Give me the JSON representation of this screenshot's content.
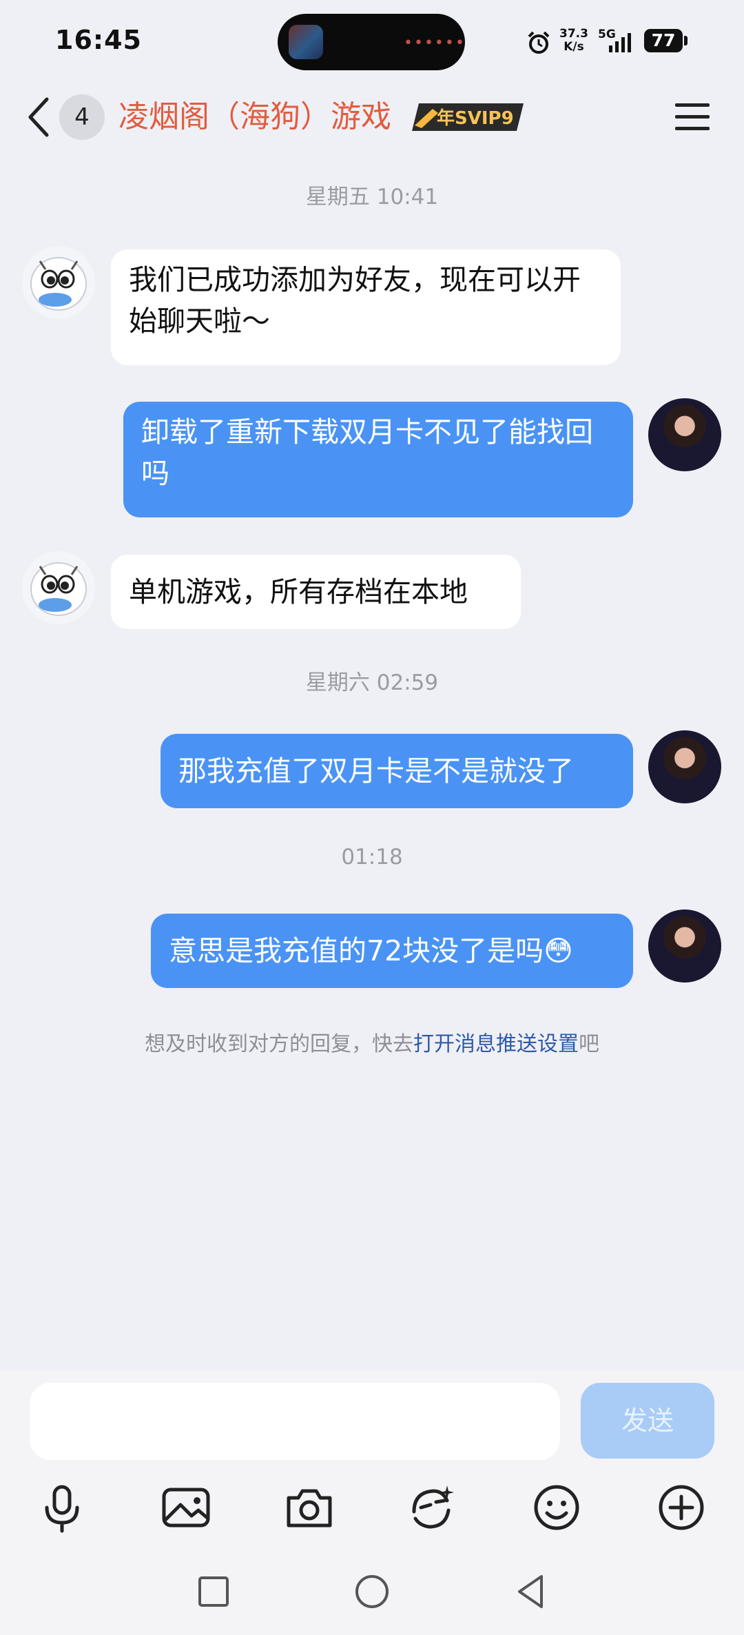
{
  "status_bar": {
    "time": "16:45",
    "net_speed_value": "37.3",
    "net_speed_unit": "K/s",
    "network": "5G",
    "battery": "77",
    "icons": [
      "app-notification-icon",
      "alarm-icon",
      "signal-icon",
      "battery-icon"
    ]
  },
  "header": {
    "unread_count": "4",
    "title": "凌烟阁（海狗）游戏",
    "vip_badge": "年SVIP9",
    "icons": [
      "back-icon",
      "menu-icon"
    ]
  },
  "messages": [
    {
      "type": "timestamp",
      "text": "星期五 10:41"
    },
    {
      "type": "incoming",
      "text": "我们已成功添加为好友，现在可以开始聊天啦～"
    },
    {
      "type": "outgoing",
      "text": "卸载了重新下载双月卡不见了能找回吗"
    },
    {
      "type": "incoming",
      "text": "单机游戏，所有存档在本地"
    },
    {
      "type": "timestamp",
      "text": "星期六 02:59"
    },
    {
      "type": "outgoing",
      "text": "那我充值了双月卡是不是就没了"
    },
    {
      "type": "timestamp",
      "text": "01:18"
    },
    {
      "type": "outgoing",
      "text": "意思是我充值的72块没了是吗😳"
    }
  ],
  "hint": {
    "prefix": "想及时收到对方的回复，快去",
    "link": "打开消息推送设置",
    "suffix": "吧"
  },
  "composer": {
    "input_value": "",
    "send_label": "发送"
  },
  "toolbar": [
    "microphone-icon",
    "image-icon",
    "camera-icon",
    "sticker-icon",
    "emoji-icon",
    "plus-icon"
  ],
  "nav_bar": [
    "square-icon",
    "circle-icon",
    "triangle-back-icon"
  ],
  "colors": {
    "background": "#eff0f5",
    "outgoing_bubble": "#4a93f5",
    "incoming_bubble": "#ffffff",
    "title": "#e25c3f",
    "link": "#2f5aa8",
    "send_disabled": "#a8ccf6"
  }
}
